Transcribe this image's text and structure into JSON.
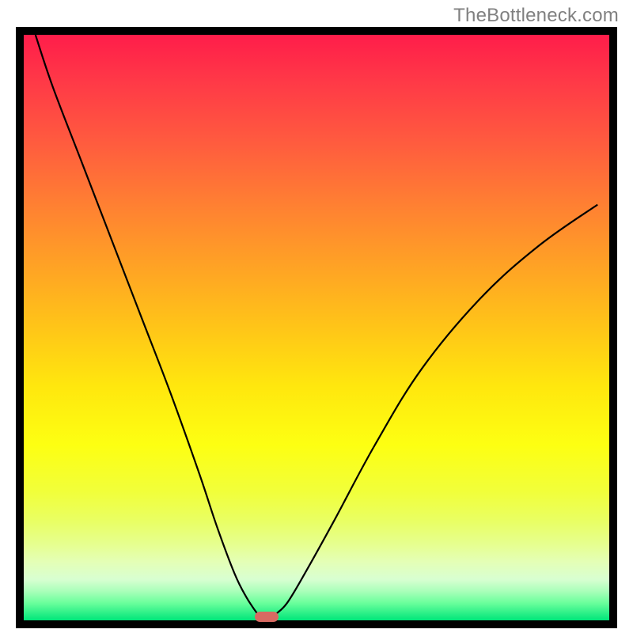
{
  "watermark": "TheBottleneck.com",
  "colors": {
    "frame": "#000000",
    "curve": "#000000",
    "marker": "#d86a62",
    "gradient_top": "#ff1d4a",
    "gradient_bottom": "#00e67a"
  },
  "chart_data": {
    "type": "line",
    "title": "",
    "xlabel": "",
    "ylabel": "",
    "xlim": [
      0,
      100
    ],
    "ylim": [
      0,
      100
    ],
    "grid": false,
    "legend": false,
    "series": [
      {
        "name": "bottleneck-curve",
        "x": [
          2,
          5,
          10,
          15,
          20,
          25,
          30,
          33,
          36,
          38,
          40,
          41,
          42,
          43,
          45,
          48,
          53,
          60,
          68,
          78,
          88,
          98
        ],
        "values": [
          100,
          91,
          78,
          65,
          52,
          39,
          25,
          16,
          8,
          4,
          1,
          0,
          0,
          1,
          3,
          8,
          17,
          30,
          43,
          55,
          64,
          71
        ]
      }
    ],
    "annotations": [
      {
        "name": "optimal-marker",
        "x": 41.5,
        "y": 0
      }
    ]
  }
}
